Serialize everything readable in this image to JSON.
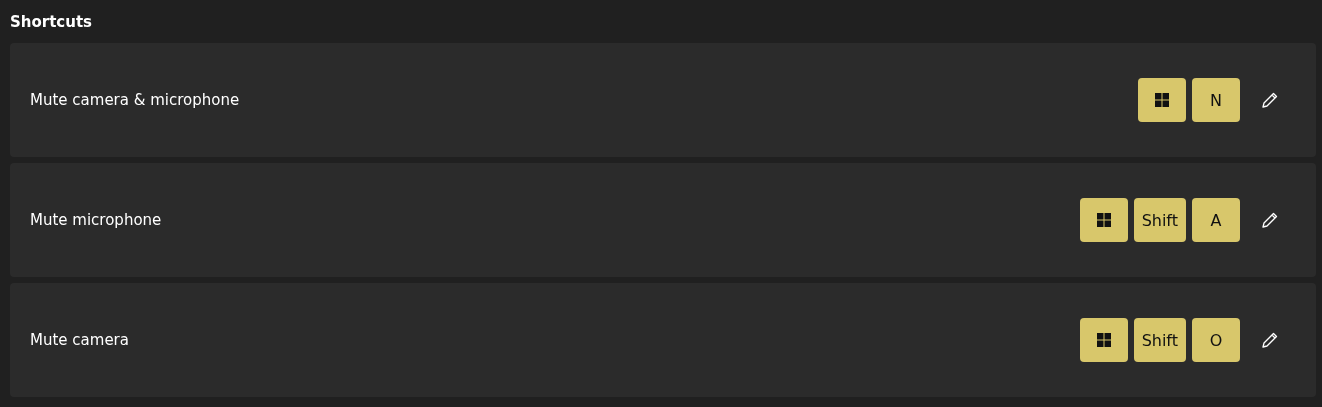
{
  "section_title": "Shortcuts",
  "shortcuts": [
    {
      "label": "Mute camera & microphone",
      "keys": [
        {
          "kind": "windows"
        },
        {
          "kind": "text",
          "label": "N"
        }
      ]
    },
    {
      "label": "Mute microphone",
      "keys": [
        {
          "kind": "windows"
        },
        {
          "kind": "text",
          "label": "Shift"
        },
        {
          "kind": "text",
          "label": "A"
        }
      ]
    },
    {
      "label": "Mute camera",
      "keys": [
        {
          "kind": "windows"
        },
        {
          "kind": "text",
          "label": "Shift"
        },
        {
          "kind": "text",
          "label": "O"
        }
      ]
    }
  ]
}
